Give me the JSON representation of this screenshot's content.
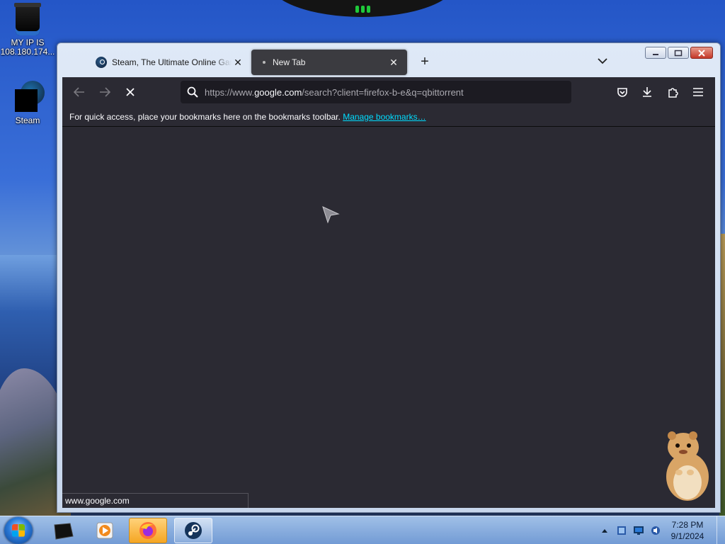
{
  "desktop": {
    "icons": [
      {
        "label_line1": "MY IP IS",
        "label_line2": "108.180.174..."
      },
      {
        "label_line1": "Steam"
      }
    ]
  },
  "browser": {
    "tabs": [
      {
        "title": "Steam, The Ultimate Online Game Platform",
        "icon": "steam-icon",
        "active": false
      },
      {
        "title": "New Tab",
        "icon": "loading-dot",
        "active": true
      }
    ],
    "url": {
      "prefix": "https://www.",
      "host": "google.com",
      "path": "/search?client=firefox-b-e&q=qbittorrent"
    },
    "bookmarks_bar": {
      "message": "For quick access, place your bookmarks here on the bookmarks toolbar.",
      "link": "Manage bookmarks…"
    },
    "status_url": "www.google.com",
    "accent_color": "#00ddff",
    "background_color": "#2b2a33"
  },
  "taskbar": {
    "clock_time": "7:28 PM",
    "clock_date": "9/1/2024",
    "apps": [
      "file-manager-icon",
      "media-player-icon",
      "firefox-icon",
      "steam-icon"
    ]
  }
}
